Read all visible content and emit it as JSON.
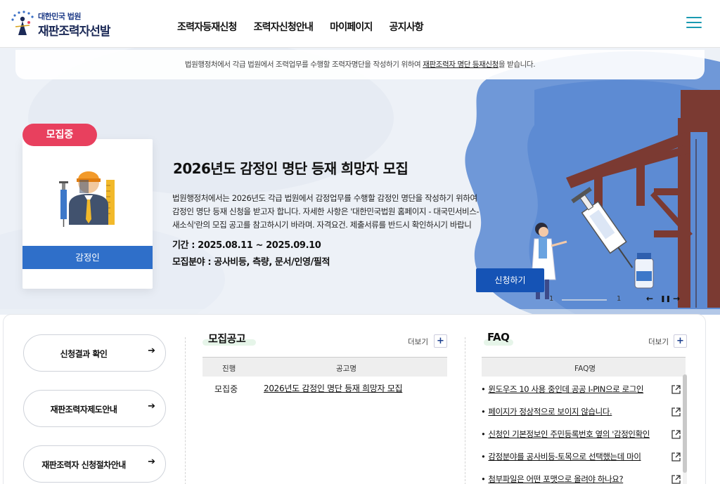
{
  "header": {
    "logo_sub": "대한민국 법원",
    "logo_main": "재판조력자선발",
    "nav": [
      "조력자등재신청",
      "조력자신청안내",
      "마이페이지",
      "공지사항"
    ]
  },
  "notice": {
    "text_before": "법원행정처에서 각급 법원에서 조력업무를 수행할 조력자명단을 작성하기 위하여 ",
    "link": "재판조력자 명단 등재신청",
    "text_after": "을 받습니다."
  },
  "hero": {
    "badge": "모집중",
    "card_label": "감정인",
    "title": "2026년도 감정인 명단 등재 희망자 모집",
    "description_lines": [
      "법원행정처에서는 2026년도 각급 법원에서 감정업무를 수행할 감정인 명단을 작성하기 위하여",
      "감정인 명단 등재 신청을 받고자 합니다. 자세한 사항은 '대한민국법원 홈페이지 - 대국민서비스-",
      "새소식'란의 모집 공고를 참고하시기 바라며. 자격요건. 제출서류를 반드시 확인하시기 바랍니"
    ],
    "period": "기간 : 2025.08.11 ~ 2025.09.10",
    "fields": "모집분야 : 공사비등, 측량, 문서/인영/필적",
    "apply_label": "신청하기",
    "slide_current": "1",
    "slide_total": "1",
    "prev": "←",
    "pause": "❚❚",
    "next": "→"
  },
  "quick_links": [
    "신청결과 확인",
    "재판조력자제도안내",
    "재판조력자 신청절차안내"
  ],
  "recruit": {
    "title": "모집공고",
    "more": "더보기",
    "headers": [
      "진행",
      "공고명"
    ],
    "rows": [
      {
        "status": "모집중",
        "title": "2026년도 감정인 명단 등재 희망자 모집"
      }
    ]
  },
  "faq": {
    "title": "FAQ",
    "more": "더보기",
    "header": "FAQ명",
    "items": [
      "윈도우즈 10 사용 중인데 공공 I-PIN으로 로그인",
      "페이지가 정상적으로 보이지 않습니다.",
      "신청인 기본정보인 주민등록번호 옆의 '감정인확인",
      "감정분야를 공사비등-토목으로 선택했는데 마이",
      "첨부파일은 어떤 포맷으로 올려야 하나요?"
    ]
  },
  "colors": {
    "badge": "#e8405e",
    "primary": "#1553b5",
    "card_footer": "#2f6fc9",
    "accent_teal": "#1a9ab1"
  }
}
